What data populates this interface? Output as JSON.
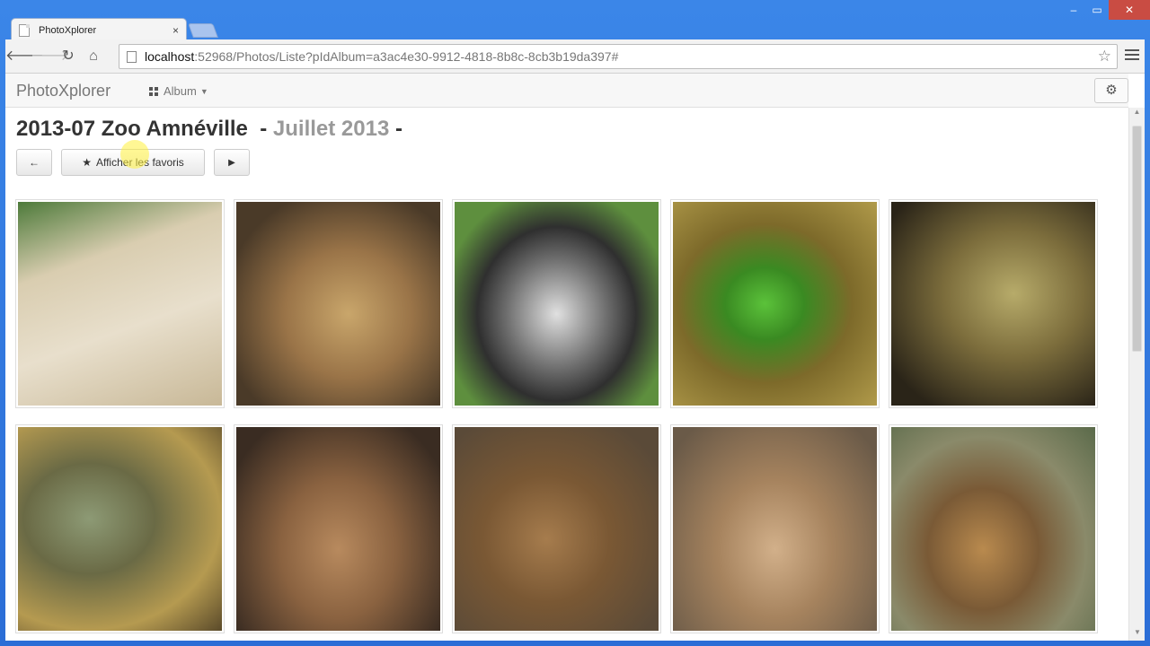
{
  "browser": {
    "tab_title": "PhotoXplorer",
    "tab_close": "×",
    "url_host": "localhost",
    "url_rest": ":52968/Photos/Liste?pIdAlbum=a3ac4e30-9912-4818-8b8c-8cb3b19da397#",
    "window_controls": {
      "minimize": "‒",
      "maximize": "▭",
      "close": "✕"
    }
  },
  "navbar": {
    "brand": "PhotoXplorer",
    "album_menu": "Album",
    "settings_icon": "gear-icon"
  },
  "header": {
    "title": "2013-07 Zoo Amnéville",
    "dash1": "-",
    "subtitle": "Juillet 2013",
    "dash2": "-"
  },
  "buttons": {
    "prev": "←",
    "favorites": "Afficher les favoris",
    "next": "▶"
  },
  "photos": [
    {
      "name": "white-lioness-photo",
      "bg": "linear-gradient(160deg,#4d7a3a 0%,#d9cdb0 30%,#e8dfcc 60%,#c8b897 100%)"
    },
    {
      "name": "lion-photo",
      "bg": "radial-gradient(ellipse at 55% 55%,#c9a66b 0%,#9a7448 40%,#4a3a28 80%)"
    },
    {
      "name": "goat-photo",
      "bg": "radial-gradient(ellipse at 50% 55%,#e0e0e0 0%,#6d6d6d 35%,#2f2f2f 55%,#5e8f3e 80%)"
    },
    {
      "name": "green-lizard-photo",
      "bg": "radial-gradient(ellipse at 45% 50%,#5bc23a 0%,#3a8a22 25%,#7d6a2a 55%,#b09a4a 100%)"
    },
    {
      "name": "tortoise-photo",
      "bg": "radial-gradient(ellipse at 60% 45%,#b7ab6a 0%,#7c6d3c 40%,#2a2418 85%)"
    },
    {
      "name": "iguana-photo",
      "bg": "radial-gradient(ellipse at 35% 45%,#8d9a75 0%,#6a6a45 35%,#b59a50 70%,#5a4a2a 100%)"
    },
    {
      "name": "prairie-dog-photo-1",
      "bg": "radial-gradient(ellipse at 50% 60%,#b88a5e 0%,#8a6240 40%,#3a2c22 85%)"
    },
    {
      "name": "prairie-dog-photo-2",
      "bg": "radial-gradient(ellipse at 45% 55%,#a67c4d 0%,#7a5834 40%,#5a4a38 85%)"
    },
    {
      "name": "prairie-dog-photo-3",
      "bg": "radial-gradient(ellipse at 50% 60%,#d2b08a 0%,#a6835e 40%,#6a5a48 90%)"
    },
    {
      "name": "serval-photo",
      "bg": "radial-gradient(ellipse at 45% 60%,#b98a4e 0%,#7a5a36 35%,#8a8a6a 65%,#5a6a4a 100%)"
    }
  ]
}
